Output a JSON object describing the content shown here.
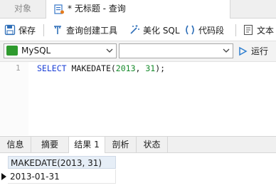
{
  "tabs": {
    "objects_label": "对象",
    "query_label": "* 无标题 - 查询"
  },
  "toolbar": {
    "save_label": "保存",
    "query_builder_label": "查询创建工具",
    "beautify_sql_label": "美化 SQL",
    "code_segment_label": "代码段",
    "text_label": "文本"
  },
  "connection": {
    "selected": "MySQL",
    "database_selected": "",
    "run_label": "运行"
  },
  "editor": {
    "line_number": "1",
    "keyword": "SELECT",
    "function": "MAKEDATE(",
    "arg1": "2013",
    "sep": ", ",
    "arg2": "31",
    "close": ");"
  },
  "result_tabs": [
    "信息",
    "摘要",
    "结果 1",
    "剖析",
    "状态"
  ],
  "result": {
    "columns": [
      "MAKEDATE(2013, 31)"
    ],
    "rows": [
      [
        "2013-01-31"
      ]
    ]
  },
  "colors": {
    "keyword": "#1a3fd6",
    "number": "#158a2a",
    "mysql_icon": "#2e9a2e",
    "run_icon": "#2f7fd0",
    "header_bg": "#e6eef7"
  }
}
